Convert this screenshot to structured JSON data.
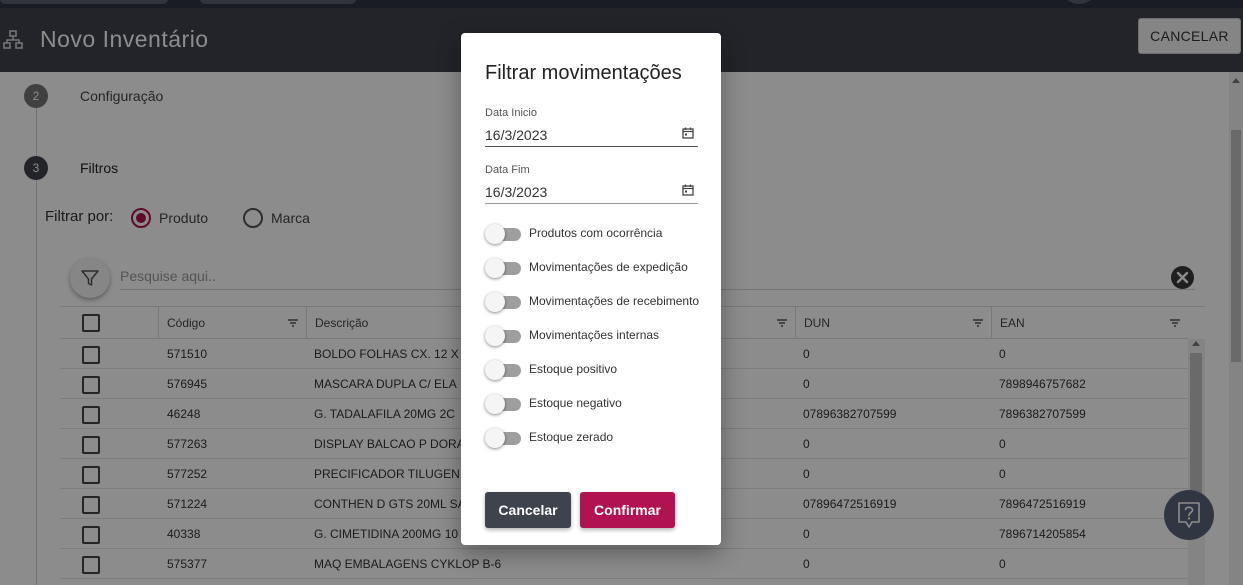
{
  "header": {
    "title": "Novo Inventário",
    "cancel_label": "CANCELAR",
    "logo_icon": "sitemap-icon"
  },
  "steps": [
    {
      "number": "2",
      "label": "Configuração",
      "active": false
    },
    {
      "number": "3",
      "label": "Filtros",
      "active": true
    }
  ],
  "filter_by": {
    "label": "Filtrar por:",
    "options": [
      {
        "label": "Produto",
        "selected": true
      },
      {
        "label": "Marca",
        "selected": false
      }
    ]
  },
  "search": {
    "placeholder": "Pesquise aqui.."
  },
  "table": {
    "columns": [
      "Código",
      "Descrição",
      "DUN",
      "EAN"
    ],
    "rows": [
      {
        "codigo": "571510",
        "descricao": "BOLDO FOLHAS CX. 12 X",
        "dun": "0",
        "ean": "0"
      },
      {
        "codigo": "576945",
        "descricao": "MASCARA DUPLA C/ ELA",
        "dun": "0",
        "ean": "7898946757682"
      },
      {
        "codigo": "46248",
        "descricao": "G. TADALAFILA 20MG 2C",
        "dun": "07896382707599",
        "ean": "7896382707599"
      },
      {
        "codigo": "577263",
        "descricao": "DISPLAY BALCAO P DORA",
        "dun": "0",
        "ean": "0"
      },
      {
        "codigo": "577252",
        "descricao": "PRECIFICADOR TILUGEN",
        "dun": "0",
        "ean": "0"
      },
      {
        "codigo": "571224",
        "descricao": "CONTHEN D GTS 20ML SA",
        "dun": "07896472516919",
        "ean": "7896472516919"
      },
      {
        "codigo": "40338",
        "descricao": "G. CIMETIDINA 200MG 10",
        "dun": "0",
        "ean": "7896714205854"
      },
      {
        "codigo": "575377",
        "descricao": "MAQ EMBALAGENS CYKLOP B-6",
        "dun": "0",
        "ean": "0"
      }
    ]
  },
  "modal": {
    "title": "Filtrar movimentações",
    "start_date": {
      "label": "Data Inicio",
      "value": "16/3/2023"
    },
    "end_date": {
      "label": "Data Fim",
      "value": "16/3/2023"
    },
    "toggles": [
      {
        "label": "Produtos com ocorrência",
        "on": false
      },
      {
        "label": "Movimentações de expedição",
        "on": false
      },
      {
        "label": "Movimentações de recebimento",
        "on": false
      },
      {
        "label": "Movimentações internas",
        "on": false
      },
      {
        "label": "Estoque positivo",
        "on": false
      },
      {
        "label": "Estoque negativo",
        "on": false
      },
      {
        "label": "Estoque zerado",
        "on": false
      }
    ],
    "cancel_label": "Cancelar",
    "confirm_label": "Confirmar"
  },
  "colors": {
    "header_bg": "#3e434d",
    "accent": "#b0134f",
    "dark_button": "#3e434d"
  }
}
